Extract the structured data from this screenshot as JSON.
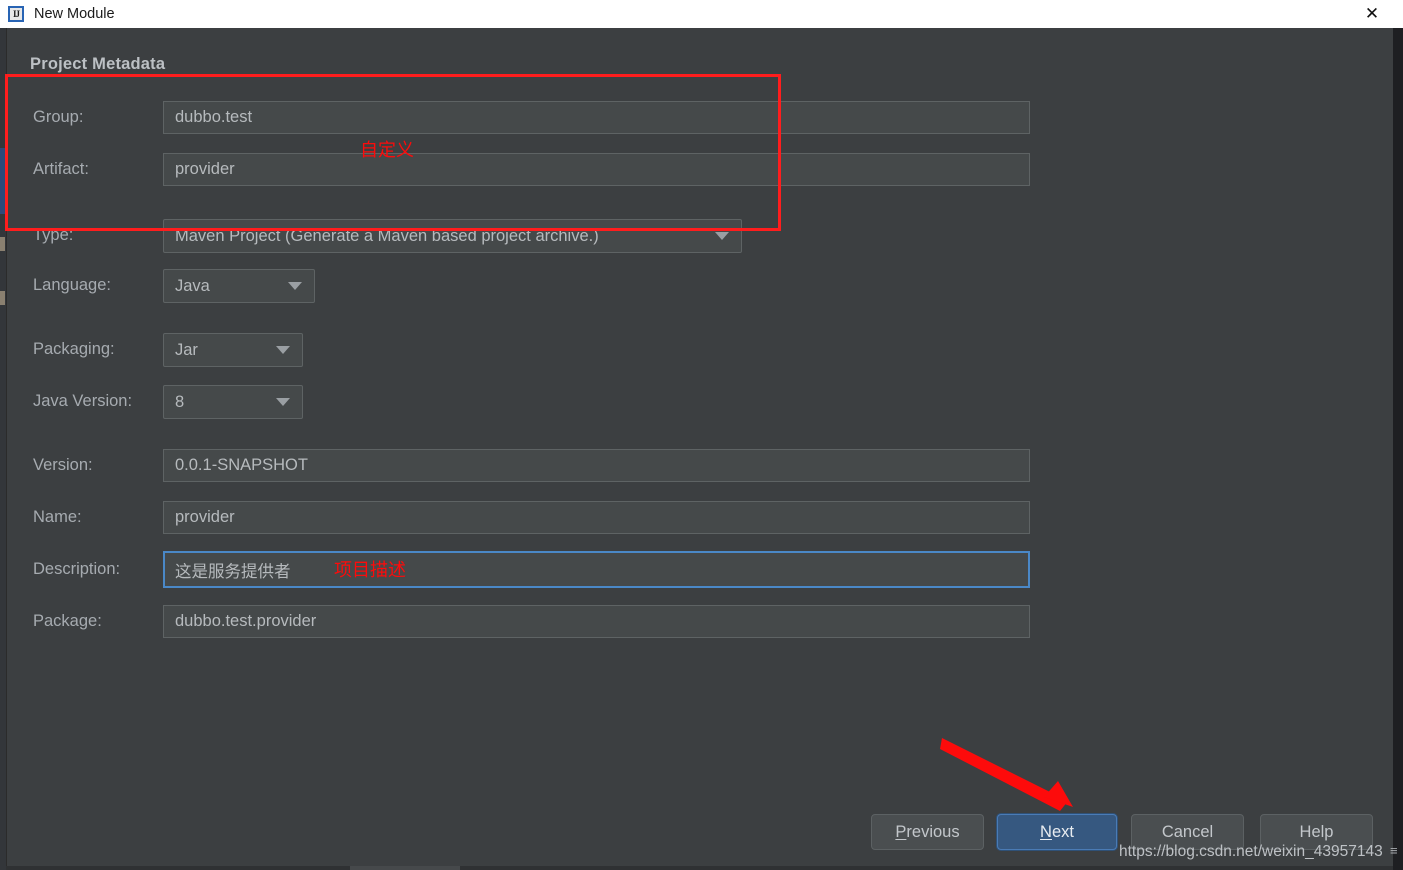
{
  "window": {
    "title": "New Module",
    "app_icon": "intellij-idea-icon",
    "close_icon": "close-icon"
  },
  "section": {
    "title": "Project Metadata"
  },
  "form": {
    "fields": [
      {
        "label": "Group:",
        "value": "dubbo.test",
        "kind": "text"
      },
      {
        "label": "Artifact:",
        "value": "provider",
        "kind": "text"
      },
      {
        "label": "Type:",
        "value": "Maven Project (Generate a Maven based project archive.)",
        "kind": "combo"
      },
      {
        "label": "Language:",
        "value": "Java",
        "kind": "combo"
      },
      {
        "label": "Packaging:",
        "value": "Jar",
        "kind": "combo"
      },
      {
        "label": "Java Version:",
        "value": "8",
        "kind": "combo"
      },
      {
        "label": "Version:",
        "value": "0.0.1-SNAPSHOT",
        "kind": "text"
      },
      {
        "label": "Name:",
        "value": "provider",
        "kind": "text"
      },
      {
        "label": "Description:",
        "value": "这是服务提供者",
        "kind": "text",
        "focused": true
      },
      {
        "label": "Package:",
        "value": "dubbo.test.provider",
        "kind": "text"
      }
    ]
  },
  "buttons": {
    "previous": {
      "pre": "P",
      "rest": "revious"
    },
    "next": {
      "pre": "N",
      "rest": "ext"
    },
    "cancel": "Cancel",
    "help": "Help"
  },
  "annotations": {
    "custom_note": "自定义",
    "description_note": "项目描述",
    "box_color": "#ff1d1d",
    "arrow_color": "#fd0b0b"
  },
  "watermark": {
    "url": "https://blog.csdn.net/weixin_43957143",
    "tick": "≡"
  },
  "colors": {
    "dialog_bg": "#3c3f41",
    "field_bg": "#45494a",
    "accent_blue": "#365880",
    "focus_blue": "#4a88c7",
    "label_text": "#a6abb0",
    "titlebar_bg": "#ffffff"
  }
}
